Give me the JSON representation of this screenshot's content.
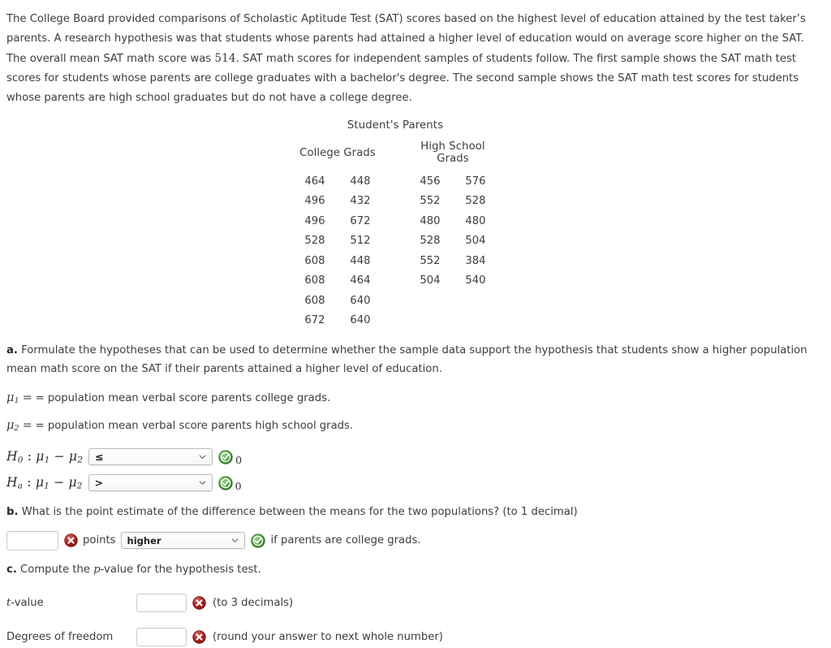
{
  "intro": {
    "part1": "The College Board provided comparisons of Scholastic Aptitude Test (SAT) scores based on the highest level of education attained by the test taker’s parents. A research hypothesis was that students whose parents had attained a higher level of education would on average score higher on the SAT. The overall mean SAT math score was ",
    "mean_score": "514",
    "part2": ". SAT math scores for independent samples of students follow. The first sample shows the SAT math test scores for students whose parents are college graduates with a bachelor's degree. The second sample shows the SAT math test scores for students whose parents are high school graduates but do not have a college degree."
  },
  "table": {
    "group_title": "Student's Parents",
    "group_title_color": "#7bd3d8",
    "headers": [
      "College Grads",
      "High School Grads"
    ],
    "college_grads": [
      [
        "464",
        "448"
      ],
      [
        "496",
        "432"
      ],
      [
        "496",
        "672"
      ],
      [
        "528",
        "512"
      ],
      [
        "608",
        "448"
      ],
      [
        "608",
        "464"
      ],
      [
        "608",
        "640"
      ],
      [
        "672",
        "640"
      ]
    ],
    "high_school_grads": [
      [
        "456",
        "576"
      ],
      [
        "552",
        "528"
      ],
      [
        "480",
        "480"
      ],
      [
        "528",
        "504"
      ],
      [
        "552",
        "384"
      ],
      [
        "504",
        "540"
      ],
      [
        "",
        ""
      ],
      [
        "",
        ""
      ]
    ]
  },
  "part_a": {
    "label": "a.",
    "question": "Formulate the hypotheses that can be used to determine whether the sample data support the hypothesis that students show a higher population mean math score on the SAT if their parents attained a higher level of education.",
    "mu1_def": "= population mean verbal score parents college grads.",
    "mu2_def": "= population mean verbal score parents high school grads.",
    "h0_prefix": "H",
    "h0_sub": "0",
    "ha_sub": "a",
    "mu_expr_mid": " : ",
    "null_operator": "≤",
    "alt_operator": ">",
    "null_value": "0",
    "alt_value": "0",
    "null_status": "correct",
    "alt_status": "correct"
  },
  "part_b": {
    "label": "b.",
    "question": "What is the point estimate of the difference between the means for the two populations? (to 1 decimal)",
    "input_value": "",
    "input_status": "incorrect",
    "points_label": "points",
    "direction_value": "higher",
    "direction_status": "correct",
    "trailing_text": "if parents are college grads."
  },
  "part_c": {
    "label": "c.",
    "question_pre": "Compute the ",
    "question_italic": "p",
    "question_post": "-value for the hypothesis test.",
    "rows": [
      {
        "label_italic": "t",
        "label_rest": "-value",
        "value": "",
        "status": "incorrect",
        "hint": "(to 3 decimals)"
      },
      {
        "label_italic": "",
        "label_rest": "Degrees of freedom",
        "value": "",
        "status": "incorrect",
        "hint": "(round your answer to next whole number)"
      }
    ]
  },
  "icons": {
    "correct": "green-check-circle-icon",
    "incorrect": "red-x-circle-icon",
    "dropdown": "chevron-down-icon",
    "correct_color": "#3f9b35",
    "incorrect_color": "#aa1f20"
  }
}
